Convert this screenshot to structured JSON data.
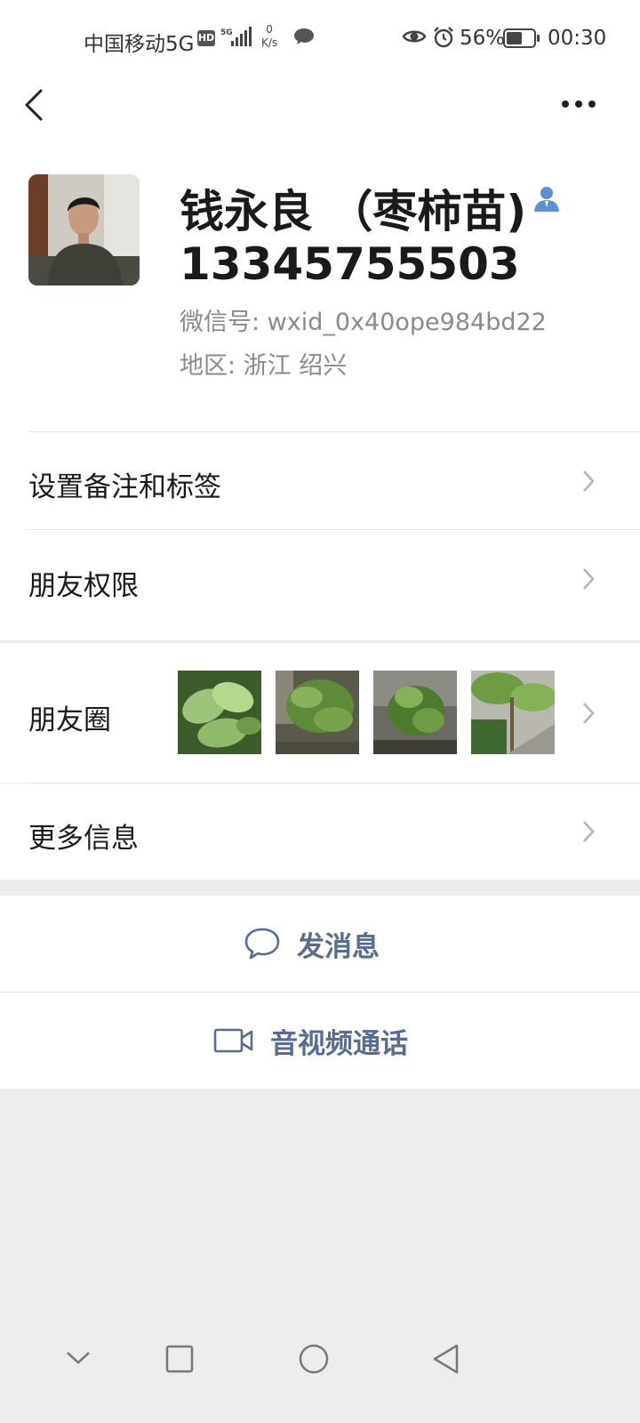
{
  "status_bar": {
    "carrier": "中国移动5G",
    "hd_badge": "HD",
    "speed_value": "0",
    "speed_unit": "K/s",
    "battery_percent": "56%",
    "time": "00:30",
    "icons": [
      "hd-icon",
      "signal-icon",
      "message-icon",
      "eye-icon",
      "alarm-icon",
      "battery-icon"
    ]
  },
  "header": {
    "back_icon": "back-chevron-icon",
    "more_icon": "more-dots-icon"
  },
  "profile": {
    "name": "钱永良 （枣柿苗)",
    "phone": "13345755503",
    "wechat_id": "微信号: wxid_0x40ope984bd22",
    "region": "地区: 浙江  绍兴",
    "badge_icon": "contact-person-icon"
  },
  "rows": {
    "set_remark": "设置备注和标签",
    "friend_permissions": "朋友权限",
    "moments": "朋友圈",
    "more_info": "更多信息"
  },
  "actions": {
    "send_message": "发消息",
    "video_call": "音视频通话"
  },
  "colors": {
    "link_blue": "#576b95",
    "background_gray": "#ededed",
    "contact_icon_blue": "#5b8fd6"
  }
}
